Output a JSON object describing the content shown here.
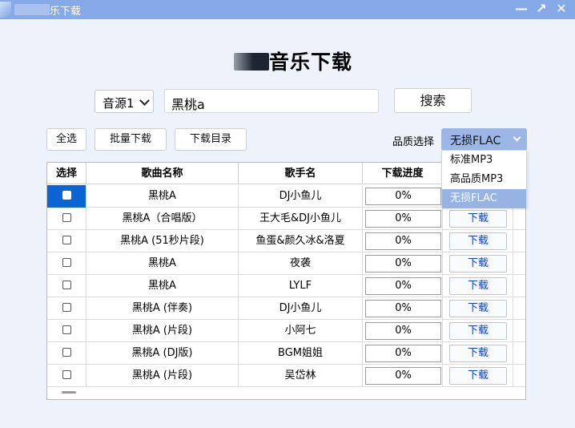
{
  "window": {
    "title": "乐下载",
    "min_label": "—",
    "max_label": "↗",
    "close_label": "✕"
  },
  "heading": "音乐下载",
  "search": {
    "source_value": "音源1",
    "query": "黑桃a",
    "button_label": "搜索"
  },
  "toolbar": {
    "select_all": "全选",
    "batch_download": "批量下载",
    "download_dir": "下载目录",
    "quality_label": "品质选择",
    "quality_value": "无损FLAC"
  },
  "quality_options": [
    "标准MP3",
    "高品质MP3",
    "无损FLAC"
  ],
  "table": {
    "headers": [
      "选择",
      "歌曲名称",
      "歌手名",
      "下载进度",
      ""
    ],
    "download_label": "下载",
    "rows": [
      {
        "name": "黑桃A",
        "artist": "DJ小鱼儿",
        "progress": "0%"
      },
      {
        "name": "黑桃A（合唱版）",
        "artist": "王大毛&DJ小鱼儿",
        "progress": "0%"
      },
      {
        "name": "黑桃A (51秒片段)",
        "artist": "鱼蛋&颜久冰&洛夏",
        "progress": "0%"
      },
      {
        "name": "黑桃A",
        "artist": "夜袭",
        "progress": "0%"
      },
      {
        "name": "黑桃A",
        "artist": "LYLF",
        "progress": "0%"
      },
      {
        "name": "黑桃A (伴奏)",
        "artist": "DJ小鱼儿",
        "progress": "0%"
      },
      {
        "name": "黑桃A (片段)",
        "artist": "小阿七",
        "progress": "0%"
      },
      {
        "name": "黑桃A (DJ版)",
        "artist": "BGM姐姐",
        "progress": "0%"
      },
      {
        "name": "黑桃A (片段)",
        "artist": "吴岱林",
        "progress": "0%"
      }
    ]
  },
  "colors": {
    "titlebar": "#86a9e8",
    "accent": "#97b3e4",
    "selected_row": "#0a64d4",
    "download_text": "#1040c8"
  }
}
